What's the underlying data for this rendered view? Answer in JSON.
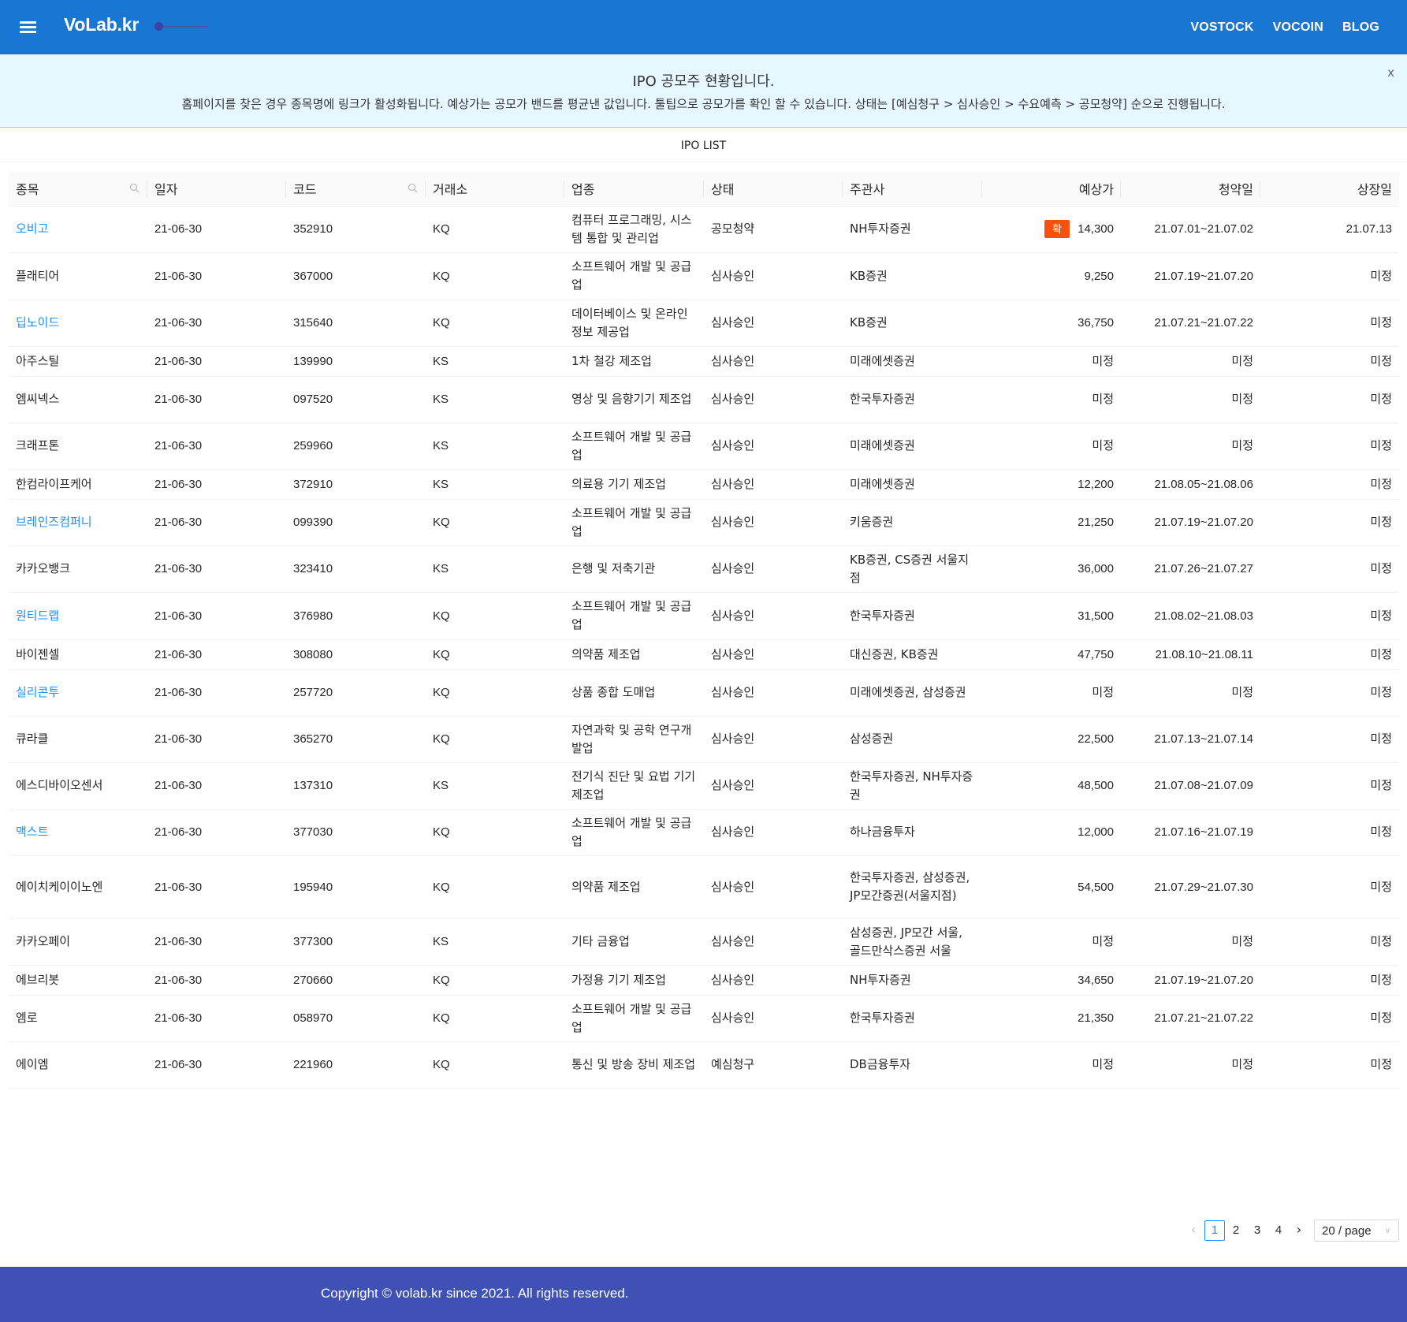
{
  "header": {
    "brand": "VoLab.kr",
    "nav": [
      "VOSTOCK",
      "VOCOIN",
      "BLOG"
    ]
  },
  "alert": {
    "title": "IPO 공모주 현황입니다.",
    "description": "홈페이지를 찾은 경우 종목명에 링크가 활성화됩니다. 예상가는 공모가 밴드를 평균낸 값입니다. 툴팁으로 공모가를 확인 할 수 있습니다. 상태는 [예심청구 > 심사승인 > 수요예측 > 공모청약] 순으로 진행됩니다.",
    "close": "x"
  },
  "list_title": "IPO LIST",
  "table": {
    "columns": [
      "종목",
      "일자",
      "코드",
      "거래소",
      "업종",
      "상태",
      "주관사",
      "예상가",
      "청약일",
      "상장일"
    ],
    "confirm_tag": "확",
    "rows": [
      {
        "name": "오비고",
        "link": true,
        "date": "21-06-30",
        "code": "352910",
        "market": "KQ",
        "sector": "컴퓨터 프로그래밍, 시스템 통합 및 관리업",
        "status": "공모청약",
        "underwriter": "NH투자증권",
        "price": "14,300",
        "confirmed": true,
        "subscription": "21.07.01~21.07.02",
        "listing": "21.07.13"
      },
      {
        "name": "플래티어",
        "link": false,
        "date": "21-06-30",
        "code": "367000",
        "market": "KQ",
        "sector": "소프트웨어 개발 및 공급업",
        "status": "심사승인",
        "underwriter": "KB증권",
        "price": "9,250",
        "confirmed": false,
        "subscription": "21.07.19~21.07.20",
        "listing": "미정"
      },
      {
        "name": "딥노이드",
        "link": true,
        "date": "21-06-30",
        "code": "315640",
        "market": "KQ",
        "sector": "데이터베이스 및 온라인정보 제공업",
        "status": "심사승인",
        "underwriter": "KB증권",
        "price": "36,750",
        "confirmed": false,
        "subscription": "21.07.21~21.07.22",
        "listing": "미정"
      },
      {
        "name": "아주스틸",
        "link": false,
        "date": "21-06-30",
        "code": "139990",
        "market": "KS",
        "sector": "1차 철강 제조업",
        "status": "심사승인",
        "underwriter": "미래에셋증권",
        "price": "미정",
        "confirmed": false,
        "subscription": "미정",
        "listing": "미정"
      },
      {
        "name": "엠씨넥스",
        "link": false,
        "date": "21-06-30",
        "code": "097520",
        "market": "KS",
        "sector": "영상 및 음향기기 제조업",
        "status": "심사승인",
        "underwriter": "한국투자증권",
        "price": "미정",
        "confirmed": false,
        "subscription": "미정",
        "listing": "미정"
      },
      {
        "name": "크래프톤",
        "link": false,
        "date": "21-06-30",
        "code": "259960",
        "market": "KS",
        "sector": "소프트웨어 개발 및 공급업",
        "status": "심사승인",
        "underwriter": "미래에셋증권",
        "price": "미정",
        "confirmed": false,
        "subscription": "미정",
        "listing": "미정"
      },
      {
        "name": "한컴라이프케어",
        "link": false,
        "date": "21-06-30",
        "code": "372910",
        "market": "KS",
        "sector": "의료용 기기 제조업",
        "status": "심사승인",
        "underwriter": "미래에셋증권",
        "price": "12,200",
        "confirmed": false,
        "subscription": "21.08.05~21.08.06",
        "listing": "미정"
      },
      {
        "name": "브레인즈컴퍼니",
        "link": true,
        "date": "21-06-30",
        "code": "099390",
        "market": "KQ",
        "sector": "소프트웨어 개발 및 공급업",
        "status": "심사승인",
        "underwriter": "키움증권",
        "price": "21,250",
        "confirmed": false,
        "subscription": "21.07.19~21.07.20",
        "listing": "미정"
      },
      {
        "name": "카카오뱅크",
        "link": false,
        "date": "21-06-30",
        "code": "323410",
        "market": "KS",
        "sector": "은행 및 저축기관",
        "status": "심사승인",
        "underwriter": "KB증권, CS증권 서울지점",
        "price": "36,000",
        "confirmed": false,
        "subscription": "21.07.26~21.07.27",
        "listing": "미정"
      },
      {
        "name": "원티드랩",
        "link": true,
        "date": "21-06-30",
        "code": "376980",
        "market": "KQ",
        "sector": "소프트웨어 개발 및 공급업",
        "status": "심사승인",
        "underwriter": "한국투자증권",
        "price": "31,500",
        "confirmed": false,
        "subscription": "21.08.02~21.08.03",
        "listing": "미정"
      },
      {
        "name": "바이젠셀",
        "link": false,
        "date": "21-06-30",
        "code": "308080",
        "market": "KQ",
        "sector": "의약품 제조업",
        "status": "심사승인",
        "underwriter": "대신증권, KB증권",
        "price": "47,750",
        "confirmed": false,
        "subscription": "21.08.10~21.08.11",
        "listing": "미정"
      },
      {
        "name": "실리콘투",
        "link": true,
        "date": "21-06-30",
        "code": "257720",
        "market": "KQ",
        "sector": "상품 종합 도매업",
        "status": "심사승인",
        "underwriter": "미래에셋증권, 삼성증권",
        "price": "미정",
        "confirmed": false,
        "subscription": "미정",
        "listing": "미정"
      },
      {
        "name": "큐라클",
        "link": false,
        "date": "21-06-30",
        "code": "365270",
        "market": "KQ",
        "sector": "자연과학 및 공학 연구개발업",
        "status": "심사승인",
        "underwriter": "삼성증권",
        "price": "22,500",
        "confirmed": false,
        "subscription": "21.07.13~21.07.14",
        "listing": "미정"
      },
      {
        "name": "에스디바이오센서",
        "link": false,
        "date": "21-06-30",
        "code": "137310",
        "market": "KS",
        "sector": "전기식 진단 및 요법 기기 제조업",
        "status": "심사승인",
        "underwriter": "한국투자증권, NH투자증권",
        "price": "48,500",
        "confirmed": false,
        "subscription": "21.07.08~21.07.09",
        "listing": "미정"
      },
      {
        "name": "맥스트",
        "link": true,
        "date": "21-06-30",
        "code": "377030",
        "market": "KQ",
        "sector": "소프트웨어 개발 및 공급업",
        "status": "심사승인",
        "underwriter": "하나금융투자",
        "price": "12,000",
        "confirmed": false,
        "subscription": "21.07.16~21.07.19",
        "listing": "미정"
      },
      {
        "name": "에이치케이이노엔",
        "link": false,
        "date": "21-06-30",
        "code": "195940",
        "market": "KQ",
        "sector": "의약품 제조업",
        "status": "심사승인",
        "underwriter": "한국투자증권, 삼성증권, JP모간증권(서울지점)",
        "price": "54,500",
        "confirmed": false,
        "subscription": "21.07.29~21.07.30",
        "listing": "미정"
      },
      {
        "name": "카카오페이",
        "link": false,
        "date": "21-06-30",
        "code": "377300",
        "market": "KS",
        "sector": "기타 금융업",
        "status": "심사승인",
        "underwriter": "삼성증권, JP모간 서울, 골드만삭스증권 서울",
        "price": "미정",
        "confirmed": false,
        "subscription": "미정",
        "listing": "미정"
      },
      {
        "name": "에브리봇",
        "link": false,
        "date": "21-06-30",
        "code": "270660",
        "market": "KQ",
        "sector": "가정용 기기 제조업",
        "status": "심사승인",
        "underwriter": "NH투자증권",
        "price": "34,650",
        "confirmed": false,
        "subscription": "21.07.19~21.07.20",
        "listing": "미정"
      },
      {
        "name": "엠로",
        "link": false,
        "date": "21-06-30",
        "code": "058970",
        "market": "KQ",
        "sector": "소프트웨어 개발 및 공급업",
        "status": "심사승인",
        "underwriter": "한국투자증권",
        "price": "21,350",
        "confirmed": false,
        "subscription": "21.07.21~21.07.22",
        "listing": "미정"
      },
      {
        "name": "에이엠",
        "link": false,
        "date": "21-06-30",
        "code": "221960",
        "market": "KQ",
        "sector": "통신 및 방송 장비 제조업",
        "status": "예심청구",
        "underwriter": "DB금융투자",
        "price": "미정",
        "confirmed": false,
        "subscription": "미정",
        "listing": "미정"
      }
    ]
  },
  "pagination": {
    "pages": [
      "1",
      "2",
      "3",
      "4"
    ],
    "current": "1",
    "page_size": "20 / page"
  },
  "footer": {
    "copyright": "Copyright © volab.kr since 2021. All rights reserved."
  },
  "colors": {
    "primary": "#1976d2",
    "footer": "#3f51b5",
    "link": "#1890ff",
    "tag": "#f5530d",
    "alert_bg": "#e6f7ff"
  },
  "icons": [
    "menu-icon",
    "search-icon",
    "close-icon",
    "chevron-left-icon",
    "chevron-right-icon",
    "chevron-down-icon"
  ]
}
